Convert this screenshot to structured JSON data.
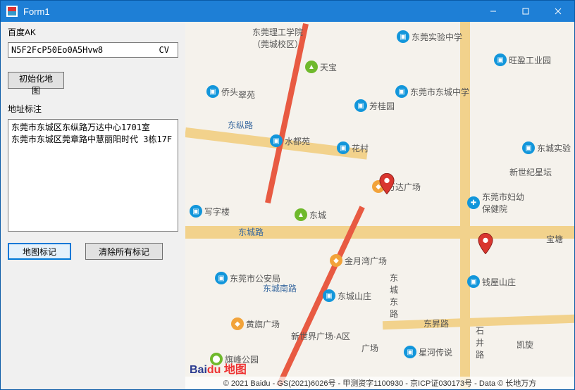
{
  "window": {
    "title": "Form1"
  },
  "left": {
    "ak_label": "百度AK",
    "ak_value": "N5F2FcP50Eo0A5Hvw8           CV",
    "init_btn": "初始化地图",
    "addr_label": "地址标注",
    "addr_text": "东莞市东城区东纵路万达中心1701室\n东莞市东城区莞章路中慧丽阳时代 3栋17F",
    "mark_btn": "地图标记",
    "clear_btn": "清除所有标记"
  },
  "map": {
    "pois": {
      "ligong": "东莞理工学院\n（莞城校区）",
      "shiyan": "东莞实验中学",
      "wangying": "旺盈工业园",
      "tianbao": "天宝",
      "qiaotou": "侨头",
      "cuiyuan": "翠苑",
      "fangguiyuan": "芳桂园",
      "dongcheng_zx": "东莞市东城中学",
      "shuiduyuan": "水都苑",
      "huacun": "花村",
      "dongcheng_sy": "东城实验",
      "xinshiji": "新世纪星坛",
      "wanda": "万达广场",
      "fuyou": "东莞市妇幼\n保健院",
      "xiezilou": "写字楼",
      "dongcheng": "东城",
      "baotang": "宝塘",
      "jinyuewan": "金月湾广场",
      "gonganju": "东莞市公安局",
      "dongchengshanzhuang": "东城山庄",
      "qianwu": "钱屋山庄",
      "huangqi": "黄旗广场",
      "xinshijie": "新世界广场·A区",
      "guangchang": "广场",
      "dongsheng": "东昇路",
      "xinghe": "星河传说",
      "shijing": "石\n井\n路",
      "kaixin": "凯旋",
      "qifeng": "旗峰公园",
      "dongchengdonglu": "东\n城\n东\n路"
    },
    "roads": {
      "dongzong": "东纵路",
      "dongchenglu": "东城路",
      "dongchengnanlu": "东城南路"
    },
    "logo": {
      "bai": "Bai",
      "du": "du",
      "ditu": "地图"
    },
    "copyright": "© 2021 Baidu - GS(2021)6026号 - 甲测资字1100930 - 京ICP证030173号 - Data © 长地万方"
  }
}
